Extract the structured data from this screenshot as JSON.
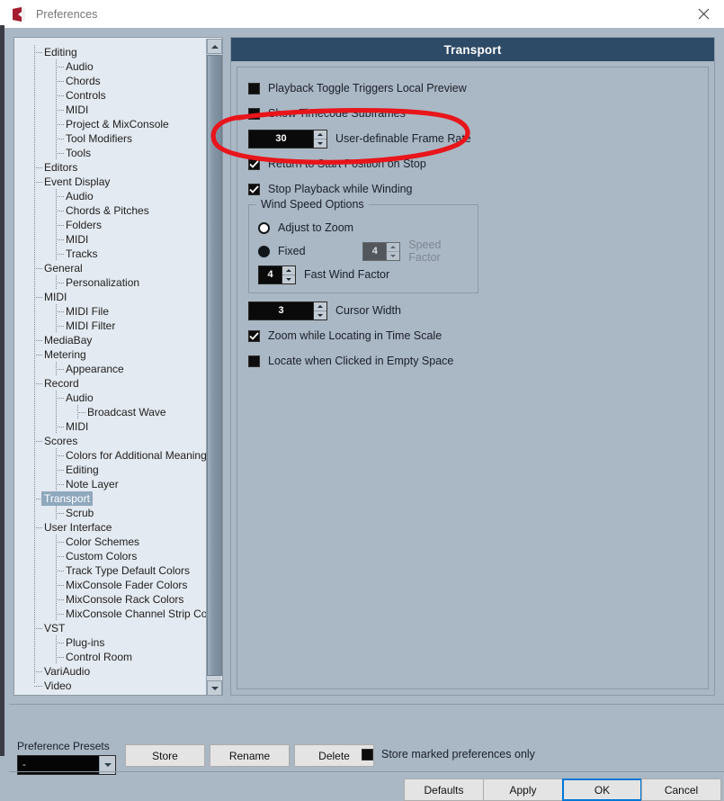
{
  "window": {
    "title": "Preferences",
    "logo_icon": "cubase-logo-icon",
    "close_icon": "close-icon"
  },
  "sidebar": {
    "scroll_up_icon": "chevron-up-icon",
    "scroll_down_icon": "chevron-down-icon",
    "items": [
      {
        "label": "Editing",
        "depth": 1,
        "selected": false
      },
      {
        "label": "Audio",
        "depth": 2,
        "selected": false
      },
      {
        "label": "Chords",
        "depth": 2,
        "selected": false
      },
      {
        "label": "Controls",
        "depth": 2,
        "selected": false
      },
      {
        "label": "MIDI",
        "depth": 2,
        "selected": false
      },
      {
        "label": "Project & MixConsole",
        "depth": 2,
        "selected": false
      },
      {
        "label": "Tool Modifiers",
        "depth": 2,
        "selected": false
      },
      {
        "label": "Tools",
        "depth": 2,
        "selected": false
      },
      {
        "label": "Editors",
        "depth": 1,
        "selected": false
      },
      {
        "label": "Event Display",
        "depth": 1,
        "selected": false
      },
      {
        "label": "Audio",
        "depth": 2,
        "selected": false
      },
      {
        "label": "Chords & Pitches",
        "depth": 2,
        "selected": false
      },
      {
        "label": "Folders",
        "depth": 2,
        "selected": false
      },
      {
        "label": "MIDI",
        "depth": 2,
        "selected": false
      },
      {
        "label": "Tracks",
        "depth": 2,
        "selected": false
      },
      {
        "label": "General",
        "depth": 1,
        "selected": false
      },
      {
        "label": "Personalization",
        "depth": 2,
        "selected": false
      },
      {
        "label": "MIDI",
        "depth": 1,
        "selected": false
      },
      {
        "label": "MIDI File",
        "depth": 2,
        "selected": false
      },
      {
        "label": "MIDI Filter",
        "depth": 2,
        "selected": false
      },
      {
        "label": "MediaBay",
        "depth": 1,
        "selected": false
      },
      {
        "label": "Metering",
        "depth": 1,
        "selected": false
      },
      {
        "label": "Appearance",
        "depth": 2,
        "selected": false
      },
      {
        "label": "Record",
        "depth": 1,
        "selected": false
      },
      {
        "label": "Audio",
        "depth": 2,
        "selected": false
      },
      {
        "label": "Broadcast Wave",
        "depth": 3,
        "selected": false
      },
      {
        "label": "MIDI",
        "depth": 2,
        "selected": false
      },
      {
        "label": "Scores",
        "depth": 1,
        "selected": false
      },
      {
        "label": "Colors for Additional Meanings",
        "depth": 2,
        "selected": false
      },
      {
        "label": "Editing",
        "depth": 2,
        "selected": false
      },
      {
        "label": "Note Layer",
        "depth": 2,
        "selected": false
      },
      {
        "label": "Transport",
        "depth": 1,
        "selected": true
      },
      {
        "label": "Scrub",
        "depth": 2,
        "selected": false
      },
      {
        "label": "User Interface",
        "depth": 1,
        "selected": false
      },
      {
        "label": "Color Schemes",
        "depth": 2,
        "selected": false
      },
      {
        "label": "Custom Colors",
        "depth": 2,
        "selected": false
      },
      {
        "label": "Track Type Default Colors",
        "depth": 2,
        "selected": false
      },
      {
        "label": "MixConsole Fader Colors",
        "depth": 2,
        "selected": false
      },
      {
        "label": "MixConsole Rack Colors",
        "depth": 2,
        "selected": false
      },
      {
        "label": "MixConsole Channel Strip Colors",
        "depth": 2,
        "selected": false
      },
      {
        "label": "VST",
        "depth": 1,
        "selected": false
      },
      {
        "label": "Plug-ins",
        "depth": 2,
        "selected": false
      },
      {
        "label": "Control Room",
        "depth": 2,
        "selected": false
      },
      {
        "label": "VariAudio",
        "depth": 1,
        "selected": false
      },
      {
        "label": "Video",
        "depth": 1,
        "selected": false
      }
    ]
  },
  "panel": {
    "header": "Transport",
    "options": [
      {
        "label": "Playback Toggle Triggers Local Preview",
        "checked": false
      },
      {
        "label": "Show Timecode Subframes",
        "checked": false
      }
    ],
    "frame_rate": {
      "value": "30",
      "label": "User-definable Frame Rate"
    },
    "options2": [
      {
        "label": "Return to Start Position on Stop",
        "checked": true
      },
      {
        "label": "Stop Playback while Winding",
        "checked": true
      }
    ],
    "wind_speed": {
      "title": "Wind Speed Options",
      "adjust_label": "Adjust to Zoom",
      "adjust_selected": false,
      "fixed_label": "Fixed",
      "fixed_selected": true,
      "speed_factor": {
        "value": "4",
        "label": "Speed Factor",
        "disabled": true
      },
      "fast_wind": {
        "value": "4",
        "label": "Fast Wind Factor"
      }
    },
    "cursor_width": {
      "value": "3",
      "label": "Cursor Width"
    },
    "options3": [
      {
        "label": "Zoom while Locating in Time Scale",
        "checked": true
      },
      {
        "label": "Locate when Clicked in Empty Space",
        "checked": false
      }
    ]
  },
  "footer": {
    "presets_label": "Preference Presets",
    "preset_value": "-",
    "preset_arrow_icon": "dropdown-arrow-icon",
    "store": "Store",
    "rename": "Rename",
    "delete": "Delete",
    "store_marked_label": "Store marked preferences only",
    "store_marked_checked": false,
    "defaults": "Defaults",
    "apply": "Apply",
    "ok": "OK",
    "cancel": "Cancel"
  },
  "annotation": {
    "type": "hand-drawn-red-ellipse",
    "color": "#e8151b",
    "targets": "User-definable Frame Rate field"
  }
}
